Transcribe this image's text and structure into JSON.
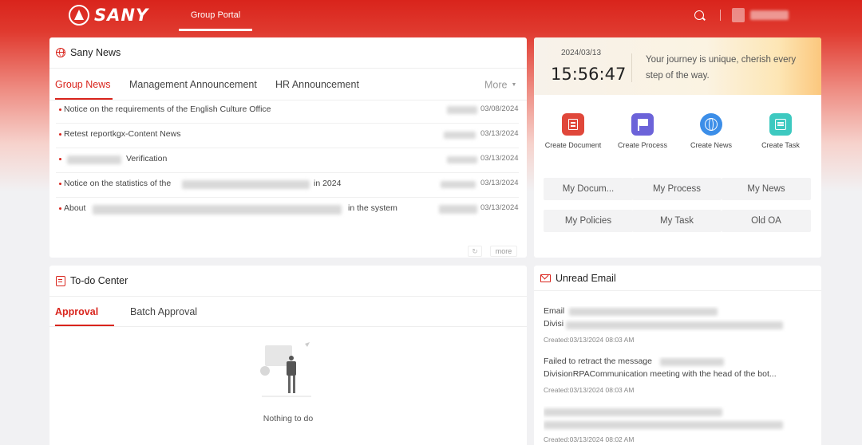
{
  "header": {
    "logo_text": "SANY",
    "nav_tab": "Group Portal"
  },
  "news": {
    "title": "Sany News",
    "tabs": [
      "Group News",
      "Management Announcement",
      "HR Announcement"
    ],
    "more_tab": "More",
    "items": [
      {
        "title": "Notice on the requirements of the English Culture Office",
        "date": "03/08/2024"
      },
      {
        "title": "Retest reportkgx-Content News",
        "date": "03/13/2024"
      },
      {
        "title": "Verification",
        "date": "03/13/2024"
      },
      {
        "title": "Notice on the statistics of the",
        "suffix": "in 2024",
        "date": "03/13/2024"
      },
      {
        "title": "About",
        "suffix": "in the system",
        "date": "03/13/2024"
      }
    ],
    "more_button": "more"
  },
  "todo": {
    "title": "To-do Center",
    "tabs": [
      "Approval",
      "Batch Approval"
    ],
    "empty_text": "Nothing to do"
  },
  "clock": {
    "date": "2024/03/13",
    "time": "15:56:47",
    "quote": "Your journey is unique, cherish every step of the way."
  },
  "quick_actions": [
    {
      "label": "Create Document",
      "icon": "document-icon",
      "color": "#e0473a"
    },
    {
      "label": "Create Process",
      "icon": "flag-icon",
      "color": "#6c63d9"
    },
    {
      "label": "Create News",
      "icon": "globe-icon",
      "color": "#3c8ee8"
    },
    {
      "label": "Create Task",
      "icon": "task-icon",
      "color": "#3dc9c0"
    }
  ],
  "shortcuts": [
    "My Docum...",
    "My Process",
    "My News",
    "My Policies",
    "My Task",
    "Old OA"
  ],
  "email": {
    "title": "Unread Email",
    "items": [
      {
        "line1": "Email",
        "line2": "Divisi",
        "created": "Created:03/13/2024 08:03 AM"
      },
      {
        "line1": "Failed to retract the message",
        "line2": "DivisionRPACommunication meeting with the head of the bot...",
        "created": "Created:03/13/2024 08:03 AM"
      },
      {
        "line1": "",
        "line2": "",
        "created": "Created:03/13/2024 08:02 AM"
      }
    ]
  },
  "colors": {
    "accent": "#d9241c"
  }
}
